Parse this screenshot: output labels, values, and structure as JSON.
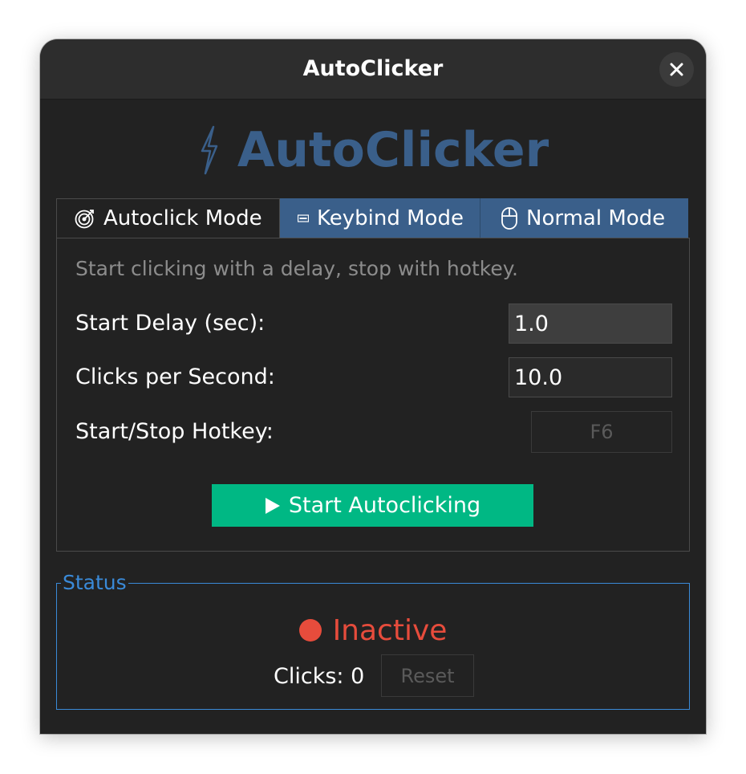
{
  "window": {
    "title": "AutoClicker",
    "close_icon": "close-icon"
  },
  "heading": {
    "icon": "lightning-bolt-icon",
    "text": "AutoClicker",
    "color": "#3a5f8a"
  },
  "tabs": [
    {
      "label": "Autoclick Mode",
      "icon": "target-icon",
      "active": true
    },
    {
      "label": "Keybind Mode",
      "icon": "keyboard-icon",
      "active": false
    },
    {
      "label": "Normal Mode",
      "icon": "mouse-icon",
      "active": false
    }
  ],
  "autoclick": {
    "description": "Start clicking with a delay, stop with hotkey.",
    "start_delay_label": "Start Delay (sec):",
    "start_delay_value": "1.0",
    "cps_label": "Clicks per Second:",
    "cps_value": "10.0",
    "hotkey_label": "Start/Stop Hotkey:",
    "hotkey_value": "F6",
    "start_button": "Start Autoclicking",
    "start_button_color": "#00b884"
  },
  "status": {
    "legend": "Status",
    "state": "Inactive",
    "state_color": "#e74c3c",
    "clicks_label": "Clicks:",
    "clicks_value": "0",
    "reset_button": "Reset"
  }
}
